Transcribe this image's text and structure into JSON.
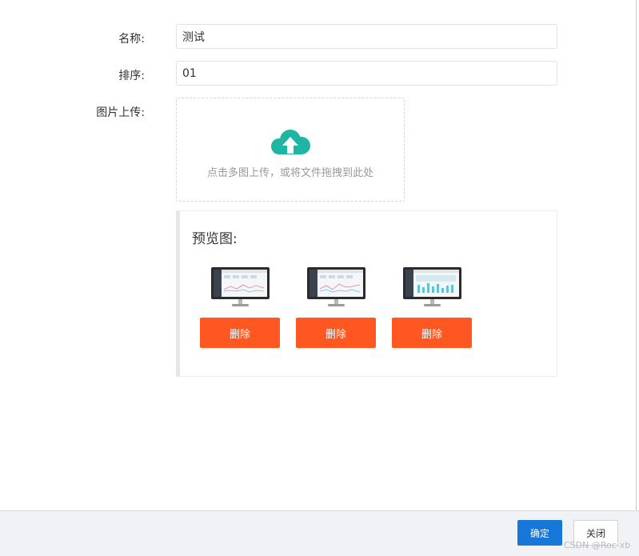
{
  "form": {
    "name_label": "名称:",
    "name_value": "测试",
    "sort_label": "排序:",
    "sort_value": "01",
    "upload_label": "图片上传:"
  },
  "upload": {
    "hint": "点击多图上传，或将文件拖拽到此处",
    "icon": "cloud-upload-icon",
    "icon_color": "#1fb5a3"
  },
  "preview": {
    "title": "预览图:",
    "items": [
      {
        "delete_label": "删除"
      },
      {
        "delete_label": "删除"
      },
      {
        "delete_label": "删除"
      }
    ],
    "delete_color": "#ff5722"
  },
  "footer": {
    "confirm_label": "确定",
    "close_label": "关闭",
    "confirm_color": "#1677d8"
  },
  "watermark": "CSDN @Roc-xb"
}
